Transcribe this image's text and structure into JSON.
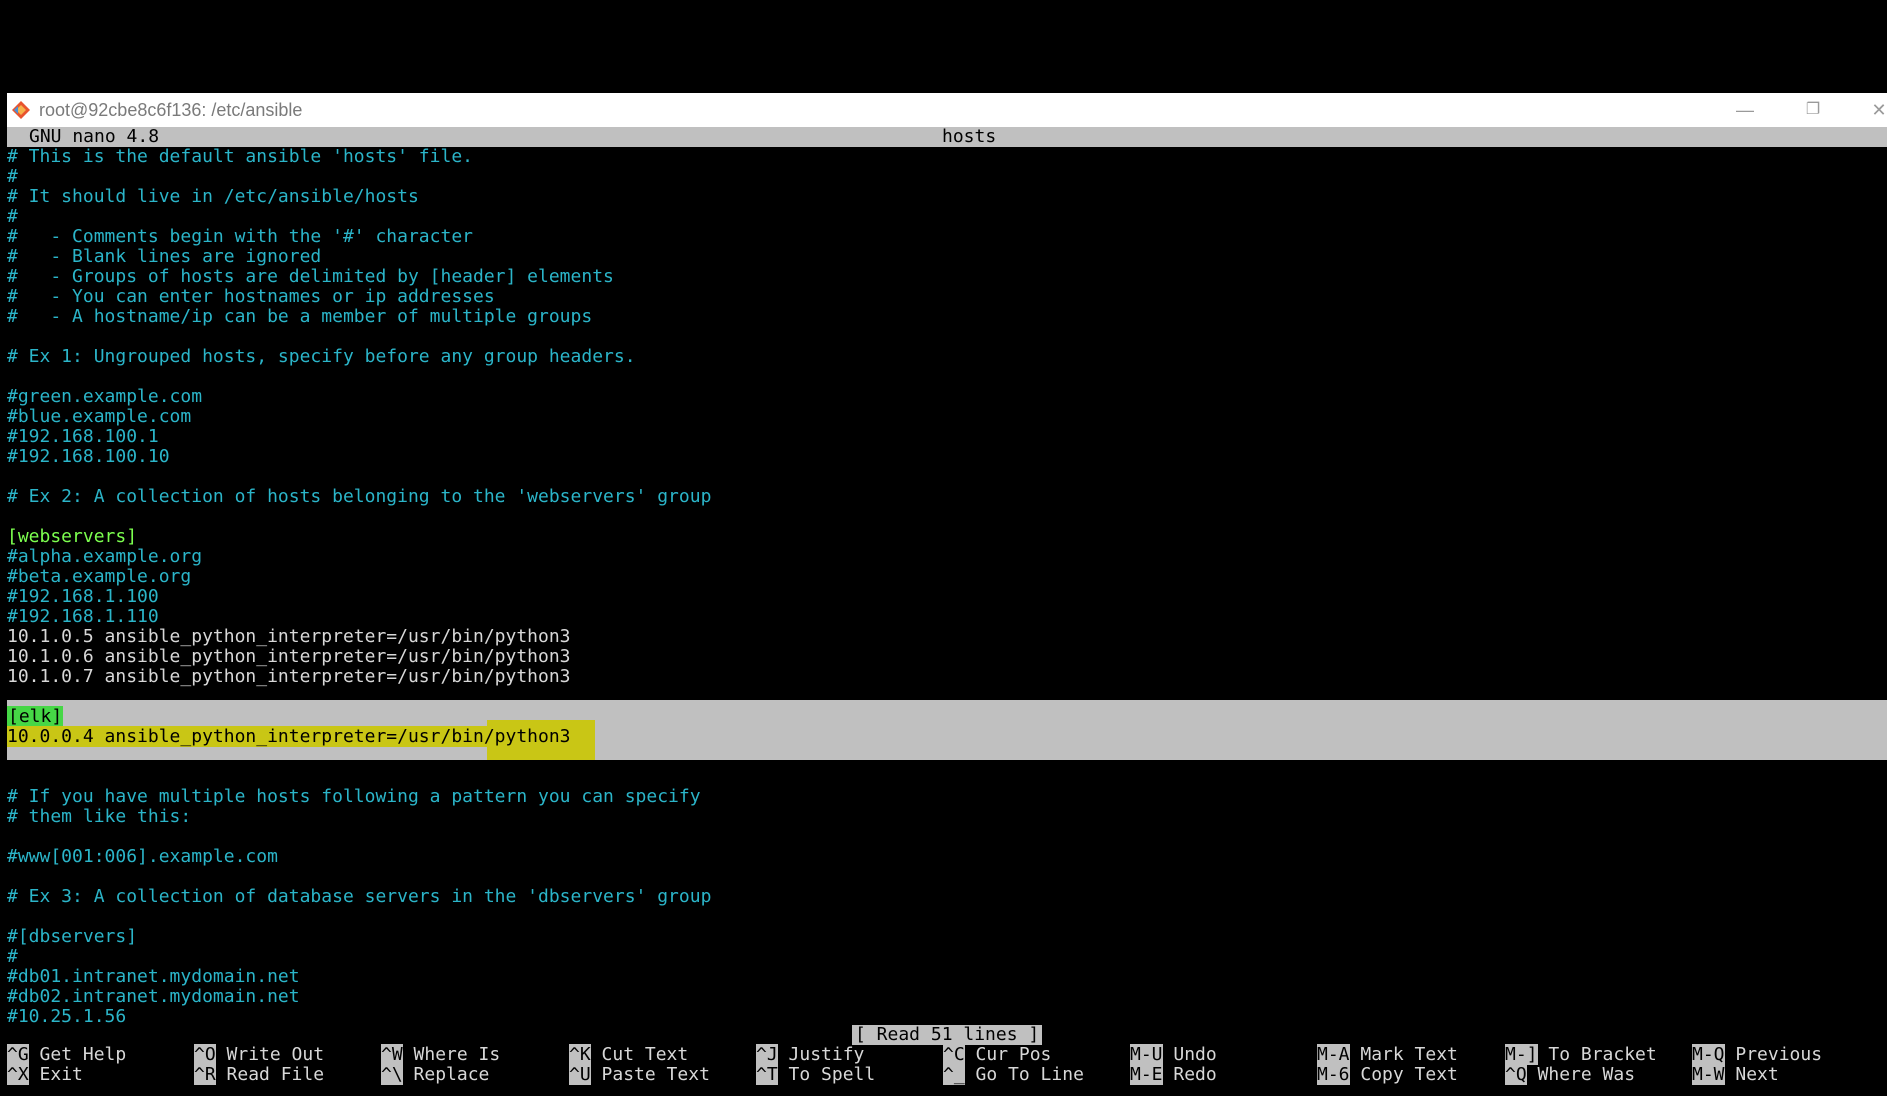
{
  "window": {
    "title": "root@92cbe8c6f136: /etc/ansible",
    "minimize": "—",
    "restore": "❐",
    "close": "✕"
  },
  "nano": {
    "version": "GNU nano 4.8",
    "filename": "hosts",
    "status": "[ Read 51 lines ]"
  },
  "lines": [
    {
      "text": "# This is the default ansible 'hosts' file.",
      "kind": "comment"
    },
    {
      "text": "#",
      "kind": "comment"
    },
    {
      "text": "# It should live in /etc/ansible/hosts",
      "kind": "comment"
    },
    {
      "text": "#",
      "kind": "comment"
    },
    {
      "text": "#   - Comments begin with the '#' character",
      "kind": "comment"
    },
    {
      "text": "#   - Blank lines are ignored",
      "kind": "comment"
    },
    {
      "text": "#   - Groups of hosts are delimited by [header] elements",
      "kind": "comment"
    },
    {
      "text": "#   - You can enter hostnames or ip addresses",
      "kind": "comment"
    },
    {
      "text": "#   - A hostname/ip can be a member of multiple groups",
      "kind": "comment"
    },
    {
      "text": "",
      "kind": "comment"
    },
    {
      "text": "# Ex 1: Ungrouped hosts, specify before any group headers.",
      "kind": "comment"
    },
    {
      "text": "",
      "kind": "comment"
    },
    {
      "text": "#green.example.com",
      "kind": "comment"
    },
    {
      "text": "#blue.example.com",
      "kind": "comment"
    },
    {
      "text": "#192.168.100.1",
      "kind": "comment"
    },
    {
      "text": "#192.168.100.10",
      "kind": "comment"
    },
    {
      "text": "",
      "kind": "comment"
    },
    {
      "text": "# Ex 2: A collection of hosts belonging to the 'webservers' group",
      "kind": "comment"
    },
    {
      "text": "",
      "kind": "comment"
    },
    {
      "text": "[webservers]",
      "kind": "section"
    },
    {
      "text": "#alpha.example.org",
      "kind": "comment"
    },
    {
      "text": "#beta.example.org",
      "kind": "comment"
    },
    {
      "text": "#192.168.1.100",
      "kind": "comment"
    },
    {
      "text": "#192.168.1.110",
      "kind": "comment"
    },
    {
      "text": "10.1.0.5 ansible_python_interpreter=/usr/bin/python3",
      "kind": "plain"
    },
    {
      "text": "10.1.0.6 ansible_python_interpreter=/usr/bin/python3",
      "kind": "plain"
    },
    {
      "text": "10.1.0.7 ansible_python_interpreter=/usr/bin/python3",
      "kind": "plain"
    },
    {
      "text": "",
      "kind": "comment"
    },
    {
      "text": "[elk]",
      "kind": "sel-elk"
    },
    {
      "text": "10.0.0.4 ansible_python_interpreter=/usr/bin/python3",
      "kind": "sel-line"
    },
    {
      "text": "",
      "kind": "comment"
    },
    {
      "text": "",
      "kind": "comment"
    },
    {
      "text": "# If you have multiple hosts following a pattern you can specify",
      "kind": "comment"
    },
    {
      "text": "# them like this:",
      "kind": "comment"
    },
    {
      "text": "",
      "kind": "comment"
    },
    {
      "text": "#www[001:006].example.com",
      "kind": "comment"
    },
    {
      "text": "",
      "kind": "comment"
    },
    {
      "text": "# Ex 3: A collection of database servers in the 'dbservers' group",
      "kind": "comment"
    },
    {
      "text": "",
      "kind": "comment"
    },
    {
      "text": "#[dbservers]",
      "kind": "comment"
    },
    {
      "text": "#",
      "kind": "comment"
    },
    {
      "text": "#db01.intranet.mydomain.net",
      "kind": "comment"
    },
    {
      "text": "#db02.intranet.mydomain.net",
      "kind": "comment"
    },
    {
      "text": "#10.25.1.56",
      "kind": "comment"
    }
  ],
  "shortcuts": [
    [
      {
        "key": "^G",
        "label": "Get Help",
        "name": "get-help"
      },
      {
        "key": "^X",
        "label": "Exit",
        "name": "exit"
      }
    ],
    [
      {
        "key": "^O",
        "label": "Write Out",
        "name": "write-out"
      },
      {
        "key": "^R",
        "label": "Read File",
        "name": "read-file"
      }
    ],
    [
      {
        "key": "^W",
        "label": "Where Is",
        "name": "where-is"
      },
      {
        "key": "^\\",
        "label": "Replace",
        "name": "replace"
      }
    ],
    [
      {
        "key": "^K",
        "label": "Cut Text",
        "name": "cut-text"
      },
      {
        "key": "^U",
        "label": "Paste Text",
        "name": "paste-text"
      }
    ],
    [
      {
        "key": "^J",
        "label": "Justify",
        "name": "justify"
      },
      {
        "key": "^T",
        "label": "To Spell",
        "name": "to-spell"
      }
    ],
    [
      {
        "key": "^C",
        "label": "Cur Pos",
        "name": "cur-pos"
      },
      {
        "key": "^_",
        "label": "Go To Line",
        "name": "go-to-line"
      }
    ],
    [
      {
        "key": "M-U",
        "label": "Undo",
        "name": "undo"
      },
      {
        "key": "M-E",
        "label": "Redo",
        "name": "redo"
      }
    ],
    [
      {
        "key": "M-A",
        "label": "Mark Text",
        "name": "mark-text"
      },
      {
        "key": "M-6",
        "label": "Copy Text",
        "name": "copy-text"
      }
    ],
    [
      {
        "key": "M-]",
        "label": "To Bracket",
        "name": "to-bracket"
      },
      {
        "key": "^Q",
        "label": "Where Was",
        "name": "where-was"
      }
    ],
    [
      {
        "key": "M-Q",
        "label": "Previous",
        "name": "previous"
      },
      {
        "key": "M-W",
        "label": "Next",
        "name": "next"
      }
    ]
  ]
}
